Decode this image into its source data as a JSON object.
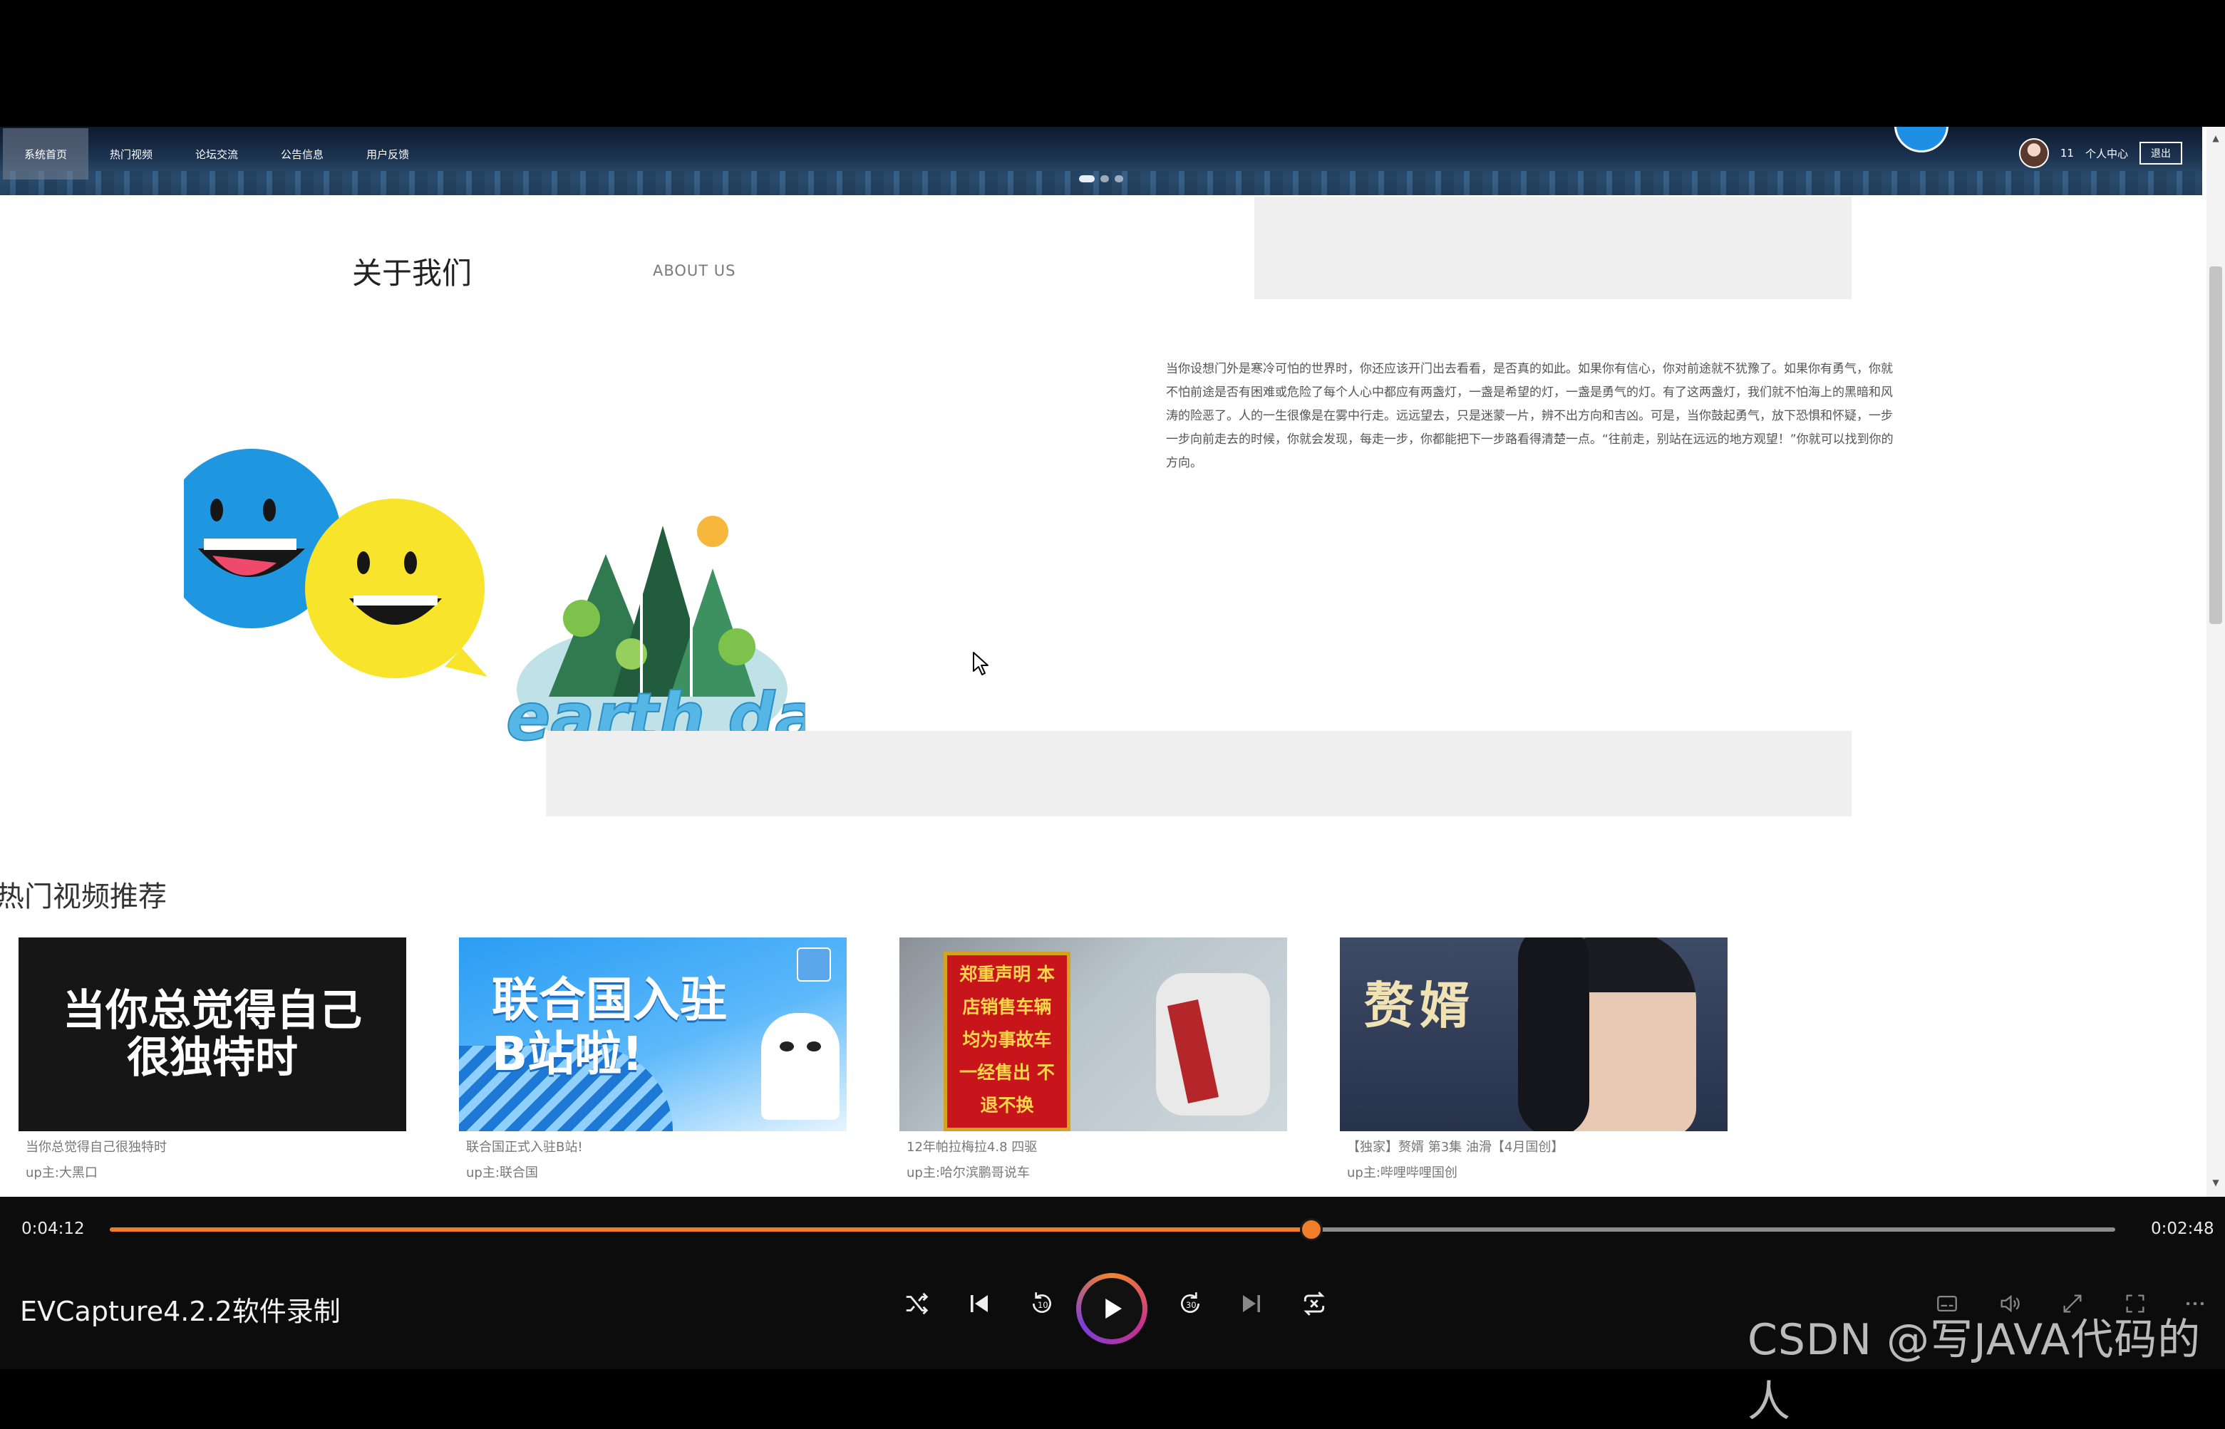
{
  "nav": {
    "items": [
      "系统首页",
      "热门视频",
      "论坛交流",
      "公告信息",
      "用户反馈"
    ],
    "active_index": 0,
    "username": "11",
    "user_center": "个人中心",
    "logout": "退出"
  },
  "about": {
    "title": "关于我们",
    "subtitle": "ABOUT US",
    "text": "当你设想门外是寒冷可怕的世界时，你还应该开门出去看看，是否真的如此。如果你有信心，你对前途就不犹豫了。如果你有勇气，你就不怕前途是否有困难或危险了每个人心中都应有两盏灯，一盏是希望的灯，一盏是勇气的灯。有了这两盏灯，我们就不怕海上的黑暗和风涛的险恶了。人的一生很像是在雾中行走。远远望去，只是迷蒙一片，辨不出方向和吉凶。可是，当你鼓起勇气，放下恐惧和怀疑，一步一步向前走去的时候，你就会发现，每走一步，你都能把下一步路看得清楚一点。“往前走，别站在远远的地方观望！”你就可以找到你的方向。",
    "illustration_text": "earth day"
  },
  "hot": {
    "title": "热门视频推荐",
    "videos": [
      {
        "thumb_text": "当你总觉得自己很独特时",
        "title": "当你总觉得自己很独特时",
        "uploader": "up主:大黑口"
      },
      {
        "thumb_text": "联合国入驻B站啦!",
        "title": "联合国正式入驻B站!",
        "uploader": "up主:联合国"
      },
      {
        "thumb_text": "郑重声明 本店销售车辆 均为事故车 一经售出 不退不换",
        "title": "12年帕拉梅拉4.8 四驱",
        "uploader": "up主:哈尔滨鹏哥说车"
      },
      {
        "thumb_text": "赘婿",
        "title": "【独家】赘婿 第3集 油滑【4月国创】",
        "uploader": "up主:哔哩哔哩国创"
      }
    ]
  },
  "player": {
    "current_time": "0:04:12",
    "total_time": "0:02:48",
    "progress": 0.599,
    "app_title": "EVCapture4.2.2软件录制",
    "watermark": "CSDN @写JAVA代码的人"
  },
  "colors": {
    "accent": "#ef7d2a",
    "player_bg": "#0c0c0c",
    "nav_bg": "#1c3350"
  },
  "icons": {
    "shuffle": "shuffle-icon",
    "previous": "skip-previous-icon",
    "rewind": "rewind-10-icon",
    "play": "play-icon",
    "forward": "forward-30-icon",
    "next": "skip-next-icon",
    "repeat": "repeat-icon",
    "subtitles": "subtitles-icon",
    "volume": "volume-icon",
    "expand": "expand-icon",
    "fullscreen": "fullscreen-icon",
    "more": "more-icon"
  }
}
